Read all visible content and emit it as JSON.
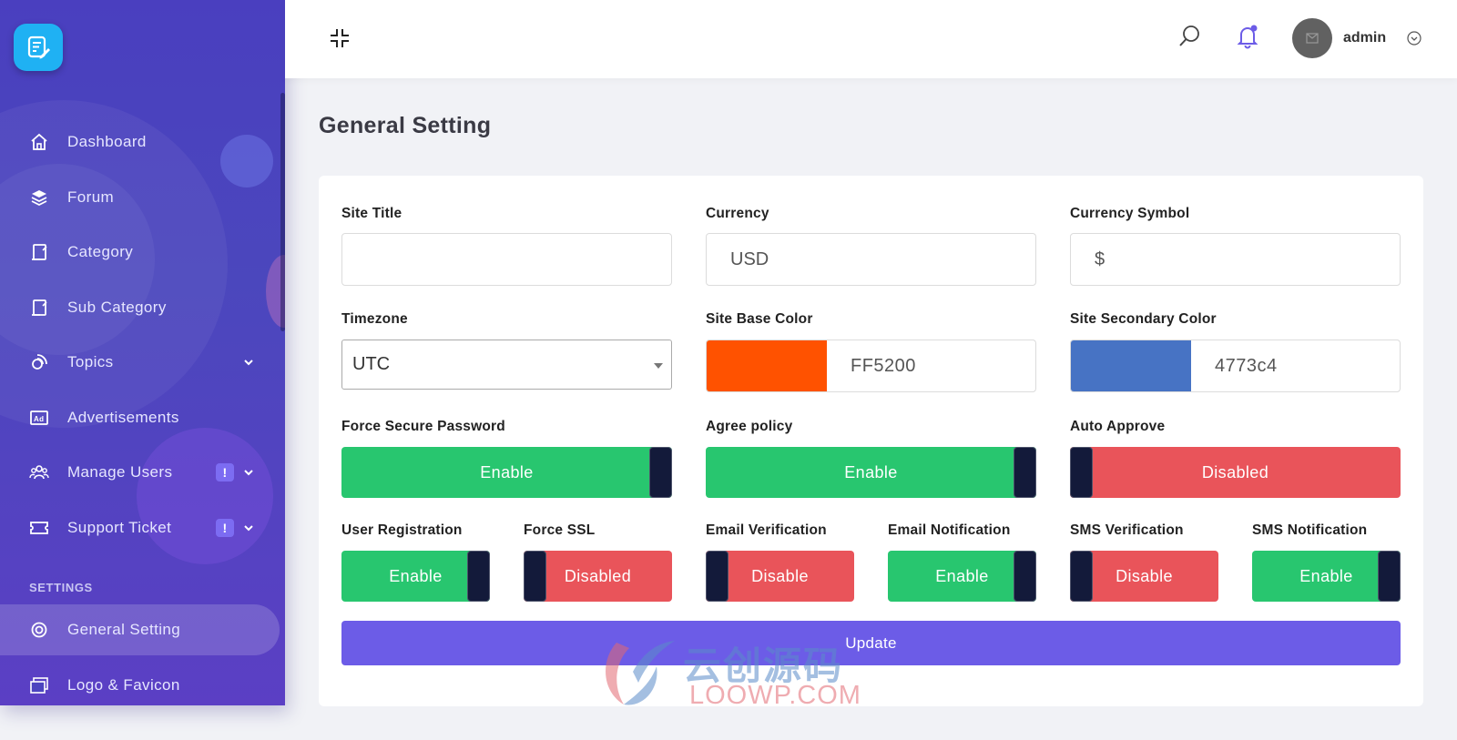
{
  "sidebar": {
    "items": [
      {
        "label": "Dashboard",
        "icon": "home-icon"
      },
      {
        "label": "Forum",
        "icon": "layers-icon"
      },
      {
        "label": "Category",
        "icon": "category-icon"
      },
      {
        "label": "Sub Category",
        "icon": "sub-category-icon"
      },
      {
        "label": "Topics",
        "icon": "topics-icon"
      },
      {
        "label": "Advertisements",
        "icon": "ad-icon"
      },
      {
        "label": "Manage Users",
        "icon": "users-icon",
        "alert": "!"
      },
      {
        "label": "Support Ticket",
        "icon": "ticket-icon",
        "alert": "!"
      }
    ],
    "section_label": "SETTINGS",
    "settings_items": [
      {
        "label": "General Setting",
        "icon": "gear-icon",
        "active": true
      },
      {
        "label": "Logo & Favicon",
        "icon": "image-icon"
      }
    ]
  },
  "header": {
    "username": "admin"
  },
  "page": {
    "title": "General Setting"
  },
  "form": {
    "site_title": {
      "label": "Site Title",
      "value": ""
    },
    "currency": {
      "label": "Currency",
      "value": "USD"
    },
    "currency_symbol": {
      "label": "Currency Symbol",
      "value": "$"
    },
    "timezone": {
      "label": "Timezone",
      "value": "UTC"
    },
    "base_color": {
      "label": "Site Base Color",
      "hex": "FF5200",
      "swatch": "#ff5200"
    },
    "secondary_color": {
      "label": "Site Secondary Color",
      "hex": "4773c4",
      "swatch": "#4773c4"
    },
    "force_secure_password": {
      "label": "Force Secure Password",
      "state": "Enable"
    },
    "agree_policy": {
      "label": "Agree policy",
      "state": "Enable"
    },
    "auto_approve": {
      "label": "Auto Approve",
      "state": "Disabled"
    },
    "user_registration": {
      "label": "User Registration",
      "state": "Enable"
    },
    "force_ssl": {
      "label": "Force SSL",
      "state": "Disabled"
    },
    "email_verification": {
      "label": "Email Verification",
      "state": "Disable"
    },
    "email_notification": {
      "label": "Email Notification",
      "state": "Enable"
    },
    "sms_verification": {
      "label": "SMS Verification",
      "state": "Disable"
    },
    "sms_notification": {
      "label": "SMS Notification",
      "state": "Enable"
    },
    "update_label": "Update"
  },
  "watermark": {
    "text_cn": "云创源码",
    "text_en": "LOOWP.COM"
  },
  "colors": {
    "sidebar_bg": "#4a44bf",
    "enable_green": "#28c66f",
    "disable_red": "#e9545a",
    "accent": "#6c5ce7"
  }
}
